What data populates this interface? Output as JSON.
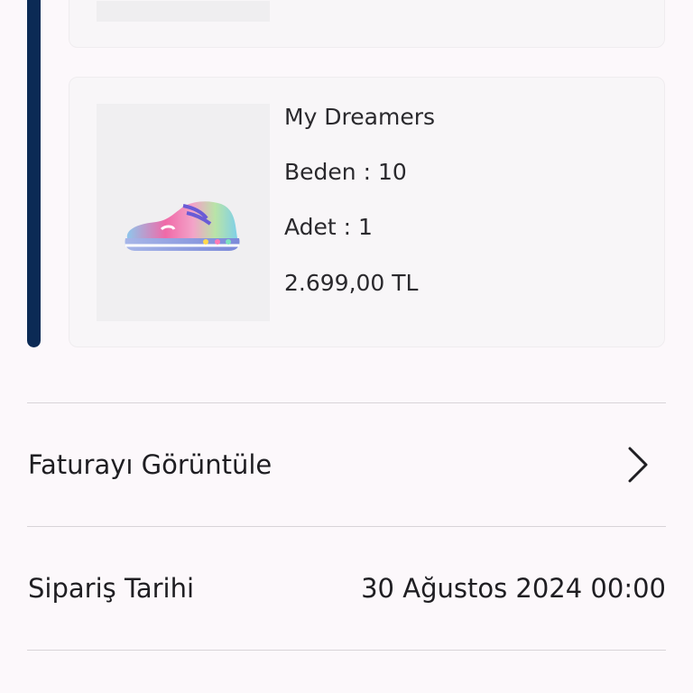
{
  "product": {
    "name": "My Dreamers",
    "size": "Beden : 10",
    "quantity": "Adet : 1",
    "price": "2.699,00 TL",
    "image": "shoe-image"
  },
  "invoice": {
    "label": "Faturayı Görüntüle",
    "icon": "chevron-right-icon"
  },
  "order_date": {
    "label": "Sipariş Tarihi",
    "value": "30 Ağustos 2024 00:00"
  },
  "colors": {
    "accent": "#0b2a55",
    "background": "#fcf8fb",
    "card": "#f8f6f8"
  }
}
